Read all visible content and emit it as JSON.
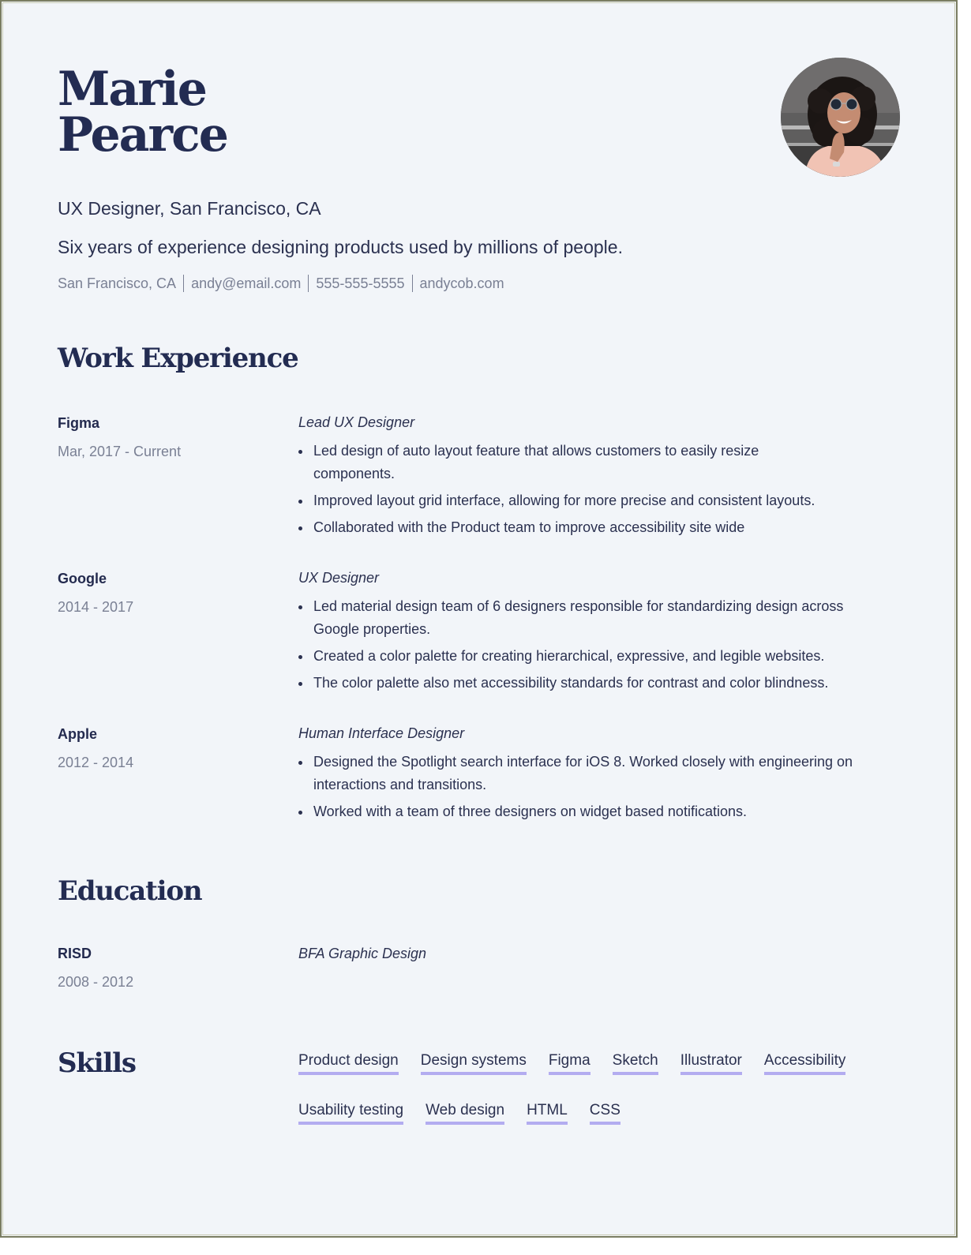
{
  "header": {
    "first_name": "Marie",
    "last_name": "Pearce",
    "subtitle": "UX Designer, San Francisco, CA",
    "summary": "Six years of experience designing products used by millions of people.",
    "contact": [
      "San Francisco, CA",
      "andy@email.com",
      "555-555-5555",
      "andycob.com"
    ],
    "photo_alt": "Profile photo of a smiling woman with curly hair and round sunglasses"
  },
  "work": {
    "title": "Work Experience",
    "entries": [
      {
        "company": "Figma",
        "dates": "Mar, 2017 - Current",
        "role": "Lead UX Designer",
        "bullets": [
          "Led design of auto layout feature that allows customers to easily resize components.",
          "Improved layout grid interface, allowing for more precise and consistent layouts.",
          "Collaborated with the Product team to improve accessibility site wide"
        ]
      },
      {
        "company": "Google",
        "dates": "2014 - 2017",
        "role": "UX Designer",
        "bullets": [
          "Led material design team of 6 designers responsible for standardizing design across Google properties.",
          "Created a color palette for creating hierarchical, expressive, and legible websites.",
          "The color palette also met accessibility standards for contrast and color blindness."
        ]
      },
      {
        "company": "Apple",
        "dates": "2012 - 2014",
        "role": "Human Interface Designer",
        "bullets": [
          "Designed the Spotlight search interface for iOS 8. Worked closely with engineering on interactions and transitions.",
          "Worked with a team of three designers on widget based notifications."
        ]
      }
    ]
  },
  "education": {
    "title": "Education",
    "entries": [
      {
        "school": "RISD",
        "dates": "2008 - 2012",
        "degree": "BFA Graphic Design"
      }
    ]
  },
  "skills": {
    "title": "Skills",
    "items": [
      "Product design",
      "Design systems",
      "Figma",
      "Sketch",
      "Illustrator",
      "Accessibility",
      "Usability testing",
      "Web design",
      "HTML",
      "CSS"
    ],
    "underline_color": "#b3acf0"
  },
  "colors": {
    "background": "#f2f5f9",
    "heading": "#232c52",
    "body_text": "#2b3150",
    "muted_text": "#7a8094"
  }
}
